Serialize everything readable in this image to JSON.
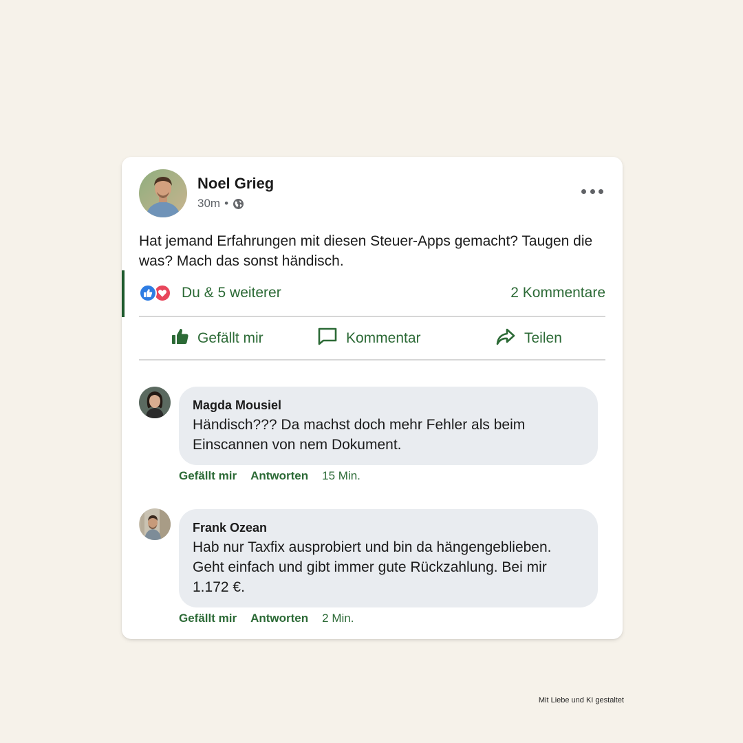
{
  "post": {
    "author": "Noel Grieg",
    "time": "30m",
    "separator": "•",
    "text": "Hat jemand Erfahrungen mit diesen Steuer-Apps gemacht? Taugen die was? Mach das sonst händisch.",
    "reactions_text": "Du & 5 weiterer",
    "comments_count": "2 Kommentare",
    "actions": {
      "like": "Gefällt mir",
      "comment": "Kommentar",
      "share": "Teilen"
    }
  },
  "comments": [
    {
      "name": "Magda Mousiel",
      "text": "Händisch??? Da machst doch mehr Fehler als beim Einscannen von nem Dokument.",
      "like": "Gefällt mir",
      "reply": "Antworten",
      "time": "15 Min."
    },
    {
      "name": "Frank Ozean",
      "text": "Hab nur Taxfix ausprobiert und bin da hängengeblieben. Geht einfach und gibt immer gute Rückzahlung. Bei mir 1.172 €.",
      "like": "Gefällt mir",
      "reply": "Antworten",
      "time": "2 Min."
    }
  ],
  "footer": "Mit Liebe und KI gestaltet",
  "colors": {
    "accent_green": "#2c6a36",
    "like_blue": "#2e7de3",
    "heart_red": "#e8465b",
    "bubble_gray": "#e9ecf0",
    "background": "#f6f2ea"
  },
  "icons": [
    "globe-icon",
    "more-options-icon",
    "like-reaction-icon",
    "heart-reaction-icon",
    "thumbs-up-icon",
    "comment-icon",
    "share-icon"
  ]
}
